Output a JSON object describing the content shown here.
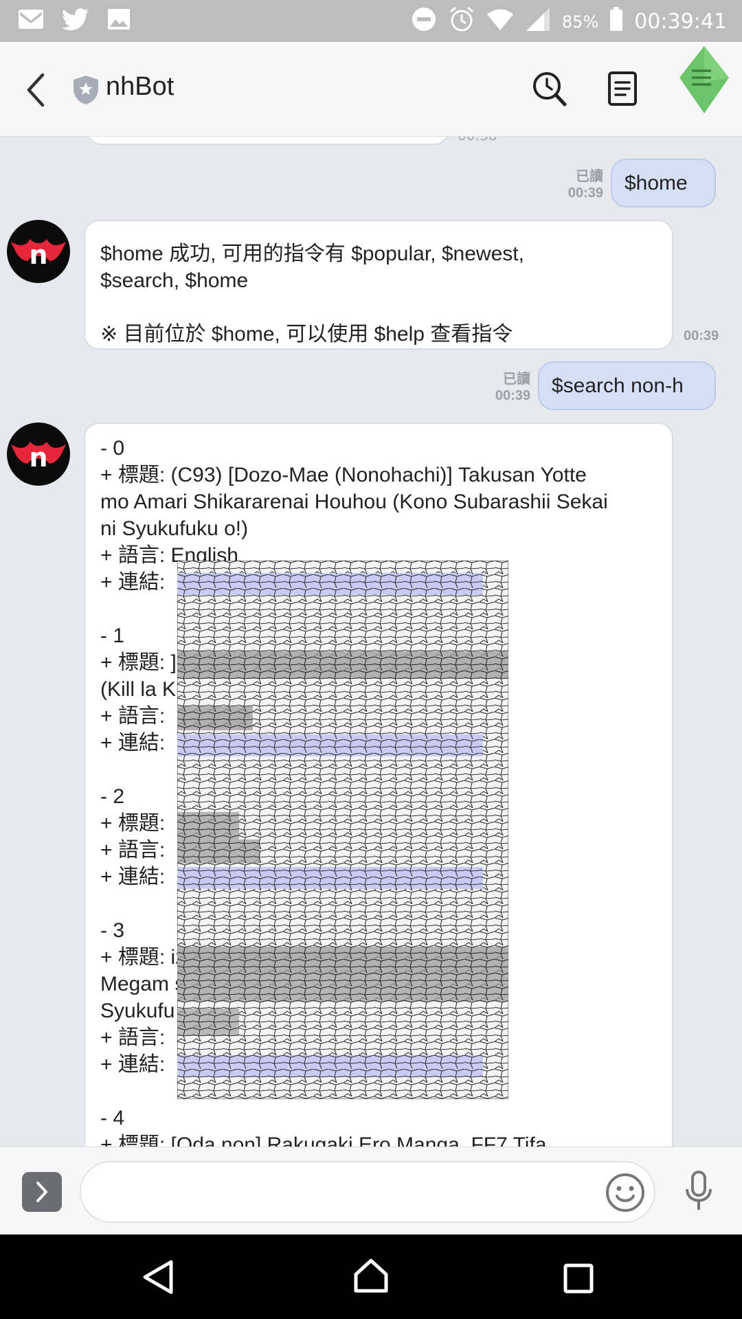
{
  "status_bar": {
    "battery_percent": "85%",
    "time": "00:39:41",
    "icons": [
      "gmail-icon",
      "twitter-icon",
      "gallery-icon",
      "do-not-disturb-icon",
      "alarm-icon",
      "wifi-icon",
      "signal-icon",
      "battery-icon"
    ]
  },
  "header": {
    "title": "nhBot",
    "icons": [
      "back-arrow-icon",
      "shield-icon",
      "search-history-icon",
      "notes-icon",
      "menu-icon"
    ]
  },
  "chat": {
    "partial_time": "00:38",
    "messages": [
      {
        "type": "sent",
        "text": "$home",
        "read_label": "已讀",
        "time": "00:39"
      },
      {
        "type": "received",
        "text": "$home 成功, 可用的指令有 $popular, $newest,\n$search, $home\n\n※ 目前位於 $home, 可以使用 $help 查看指令",
        "time": "00:39"
      },
      {
        "type": "sent",
        "text": "$search non-h",
        "read_label": "已讀",
        "time": "00:39"
      },
      {
        "type": "received",
        "lines": [
          "- 0",
          "+ 標題: (C93) [Dozo-Mae (Nonohachi)] Takusan Yotte",
          "mo Amari Shikararenai Houhou (Kono Subarashii Sekai",
          "ni Syukufuku o!)",
          "+ 語言: English",
          "+ 連結:",
          "",
          "- 1",
          "+ 標題:                                                            ] Yuri la Kill",
          "(Kill la K",
          "+ 語言:",
          "+ 連結:",
          "",
          "- 2",
          "+ 標題:",
          "+ 語言:",
          "+ 連結:",
          "",
          "- 3",
          "+ 標題:                                                            izu no",
          "Megam                                                             shii Sekai ni",
          "Syukufu",
          "+ 語言:",
          "+ 連結:",
          "",
          "- 4",
          "+ 標題: [Oda non] Rakugaki Ero Manga, FF7 Tifa"
        ]
      }
    ]
  },
  "input_bar": {
    "placeholder": "",
    "icons": [
      "chevron-right-icon",
      "emoji-icon",
      "microphone-icon"
    ]
  },
  "nav_bar": {
    "icons": [
      "nav-back-icon",
      "nav-home-icon",
      "nav-recent-icon"
    ]
  },
  "colors": {
    "sent_bubble": "#d5dff5",
    "received_bubble": "#ffffff",
    "chat_background": "#e6e9ed",
    "menu_leaf": "#6cc46a",
    "avatar_accent": "#e8263b"
  }
}
